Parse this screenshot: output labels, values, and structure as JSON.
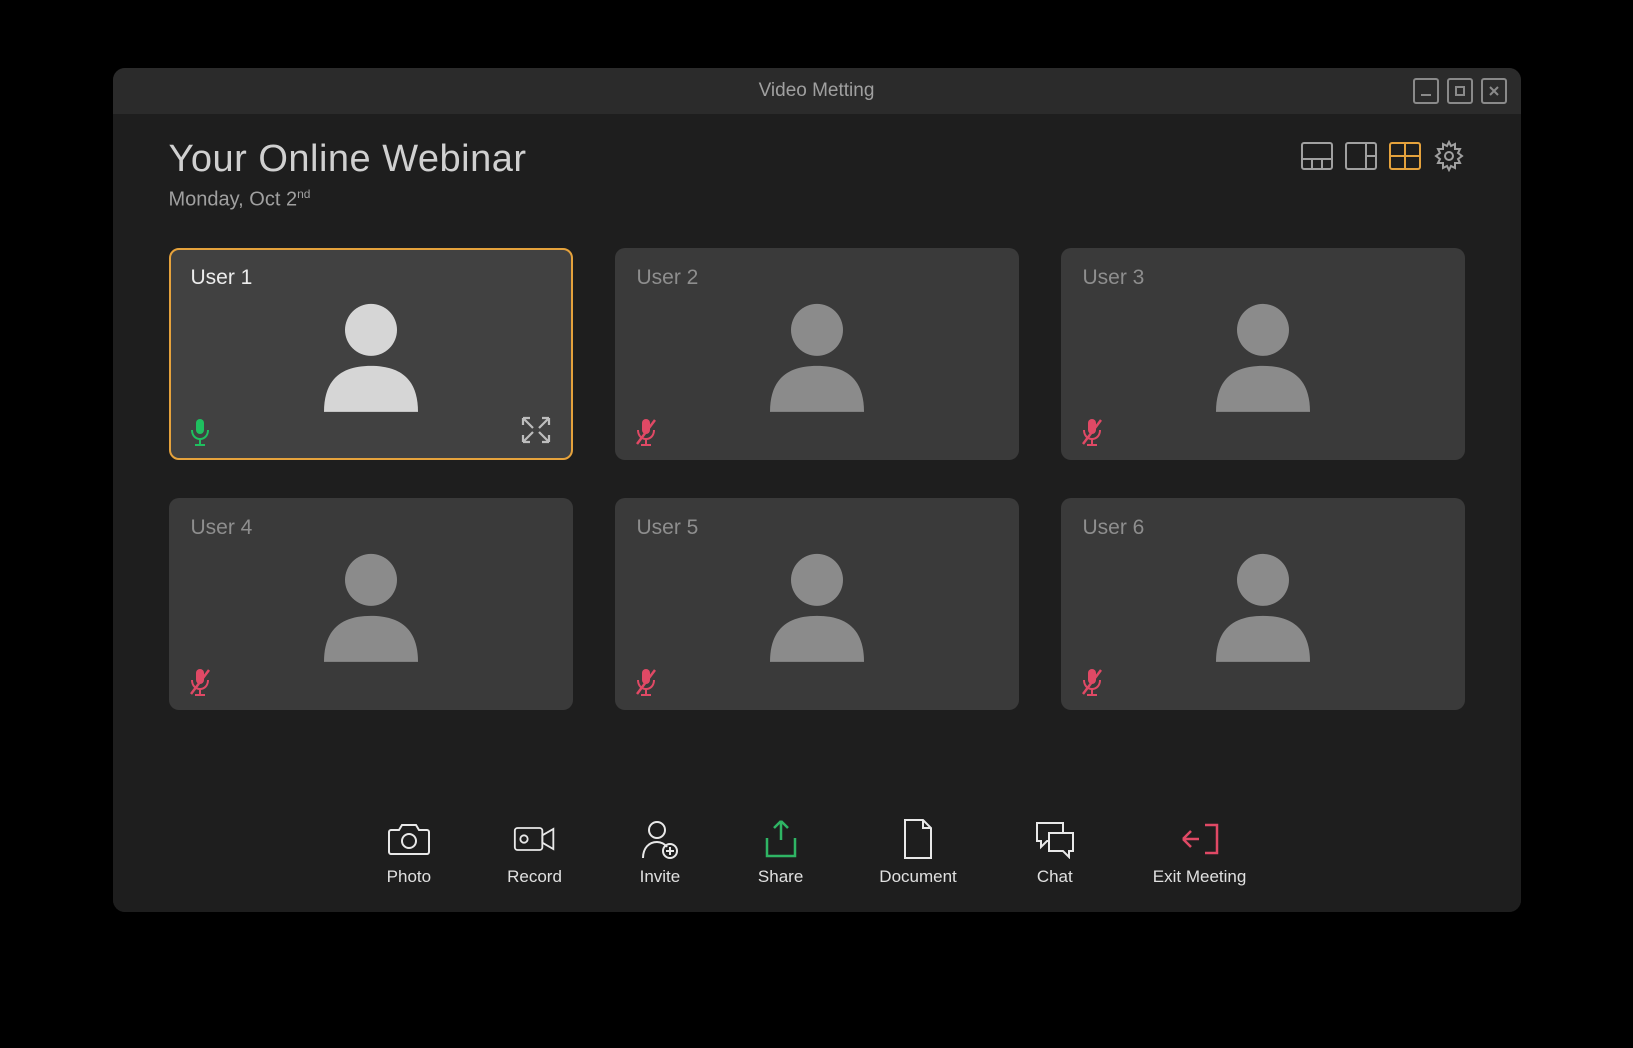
{
  "window": {
    "title": "Video Metting"
  },
  "meeting": {
    "title": "Your Online Webinar",
    "date_prefix": "Monday, Oct 2",
    "date_suffix": "nd"
  },
  "colors": {
    "accent": "#e5a23c",
    "mic_on": "#1fbf5f",
    "mic_off": "#e04965",
    "share": "#2fb564",
    "exit": "#e04965"
  },
  "participants": [
    {
      "name": "User 1",
      "mic": "on",
      "active": true,
      "expandable": true
    },
    {
      "name": "User 2",
      "mic": "off",
      "active": false,
      "expandable": false
    },
    {
      "name": "User 3",
      "mic": "off",
      "active": false,
      "expandable": false
    },
    {
      "name": "User 4",
      "mic": "off",
      "active": false,
      "expandable": false
    },
    {
      "name": "User 5",
      "mic": "off",
      "active": false,
      "expandable": false
    },
    {
      "name": "User 6",
      "mic": "off",
      "active": false,
      "expandable": false
    }
  ],
  "layout_controls": [
    {
      "id": "speaker-view",
      "active": false
    },
    {
      "id": "sidebar-view",
      "active": false
    },
    {
      "id": "grid-view",
      "active": true
    }
  ],
  "toolbar": {
    "photo": {
      "label": "Photo"
    },
    "record": {
      "label": "Record"
    },
    "invite": {
      "label": "Invite"
    },
    "share": {
      "label": "Share"
    },
    "document": {
      "label": "Document"
    },
    "chat": {
      "label": "Chat"
    },
    "exit": {
      "label": "Exit Meeting"
    }
  }
}
